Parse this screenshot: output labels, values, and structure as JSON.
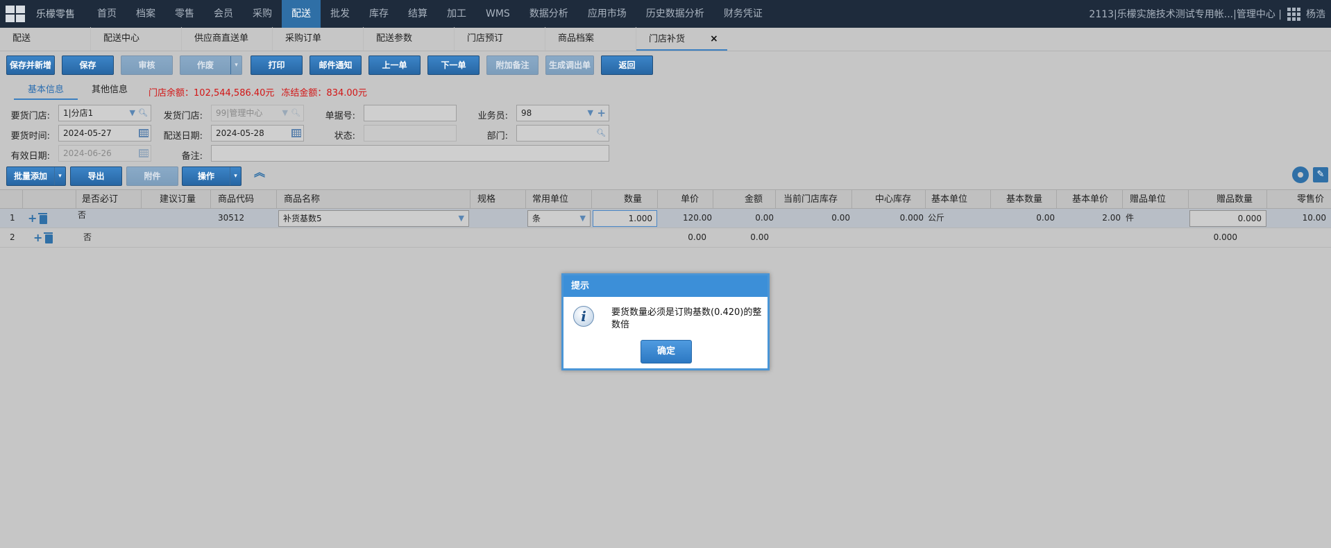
{
  "topnav": {
    "brand": "乐檬零售",
    "items": [
      "首页",
      "档案",
      "零售",
      "会员",
      "采购",
      "配送",
      "批发",
      "库存",
      "结算",
      "加工",
      "WMS",
      "数据分析",
      "应用市场",
      "历史数据分析",
      "财务凭证"
    ],
    "active_index": 5,
    "account": "2113|乐檬实施技术测试专用帐...|管理中心 |",
    "user": "杨浩"
  },
  "tabs": {
    "items": [
      "配送",
      "配送中心",
      "供应商直送单",
      "采购订单",
      "配送参数",
      "门店预订",
      "商品档案",
      "门店补货"
    ],
    "active": "门店补货",
    "close": "×"
  },
  "toolbar": {
    "save_new": "保存并新增",
    "save": "保存",
    "audit": "审核",
    "void": "作废",
    "print": "打印",
    "mail": "邮件通知",
    "prev": "上一单",
    "next": "下一单",
    "attach_note": "附加备注",
    "gen_transfer": "生成调出单",
    "back": "返回"
  },
  "info_tabs": {
    "basic": "基本信息",
    "other": "其他信息",
    "store_balance": "门店余额：102,544,586.40元",
    "frozen": "冻结金额：834.00元"
  },
  "form": {
    "req_store_label": "要货门店:",
    "req_store_value": "1|分店1",
    "send_store_label": "发货门店:",
    "send_store_value": "99|管理中心",
    "doc_no_label": "单据号:",
    "doc_no_value": "",
    "clerk_label": "业务员:",
    "clerk_value": "98",
    "req_time_label": "要货时间:",
    "req_time_value": "2024-05-27",
    "deliver_date_label": "配送日期:",
    "deliver_date_value": "2024-05-28",
    "status_label": "状态:",
    "status_value": "",
    "dept_label": "部门:",
    "dept_value": "",
    "valid_date_label": "有效日期:",
    "valid_date_value": "2024-06-26",
    "remark_label": "备注:",
    "remark_value": ""
  },
  "actions": {
    "batch_add": "批量添加",
    "export": "导出",
    "attachment": "附件",
    "operate": "操作"
  },
  "table": {
    "headers": [
      "是否必订",
      "建议订量",
      "商品代码",
      "商品名称",
      "规格",
      "常用单位",
      "数量",
      "单价",
      "金额",
      "当前门店库存",
      "中心库存",
      "基本单位",
      "基本数量",
      "基本单价",
      "赠品单位",
      "赠品数量",
      "零售价"
    ],
    "rows": [
      {
        "idx": "1",
        "required": "否",
        "suggest": "",
        "code": "30512",
        "name": "补货基数5",
        "spec": "",
        "unit": "条",
        "qty": "1.000",
        "price": "120.00",
        "amount": "0.00",
        "store_stock": "0.00",
        "center_stock": "0.000",
        "base_unit": "公斤",
        "base_qty": "0.00",
        "base_price": "2.00",
        "gift_unit": "件",
        "gift_qty": "0.000",
        "retail": "10.00"
      },
      {
        "idx": "2",
        "required": "否",
        "suggest": "",
        "code": "",
        "name": "",
        "spec": "",
        "unit": "",
        "qty": "",
        "price": "0.00",
        "amount": "0.00",
        "store_stock": "",
        "center_stock": "",
        "base_unit": "",
        "base_qty": "",
        "base_price": "",
        "gift_unit": "",
        "gift_qty": "0.000",
        "retail": ""
      }
    ]
  },
  "dialog": {
    "title": "提示",
    "message": "要货数量必须是订购基数(0.420)的整数倍",
    "ok": "确定"
  }
}
